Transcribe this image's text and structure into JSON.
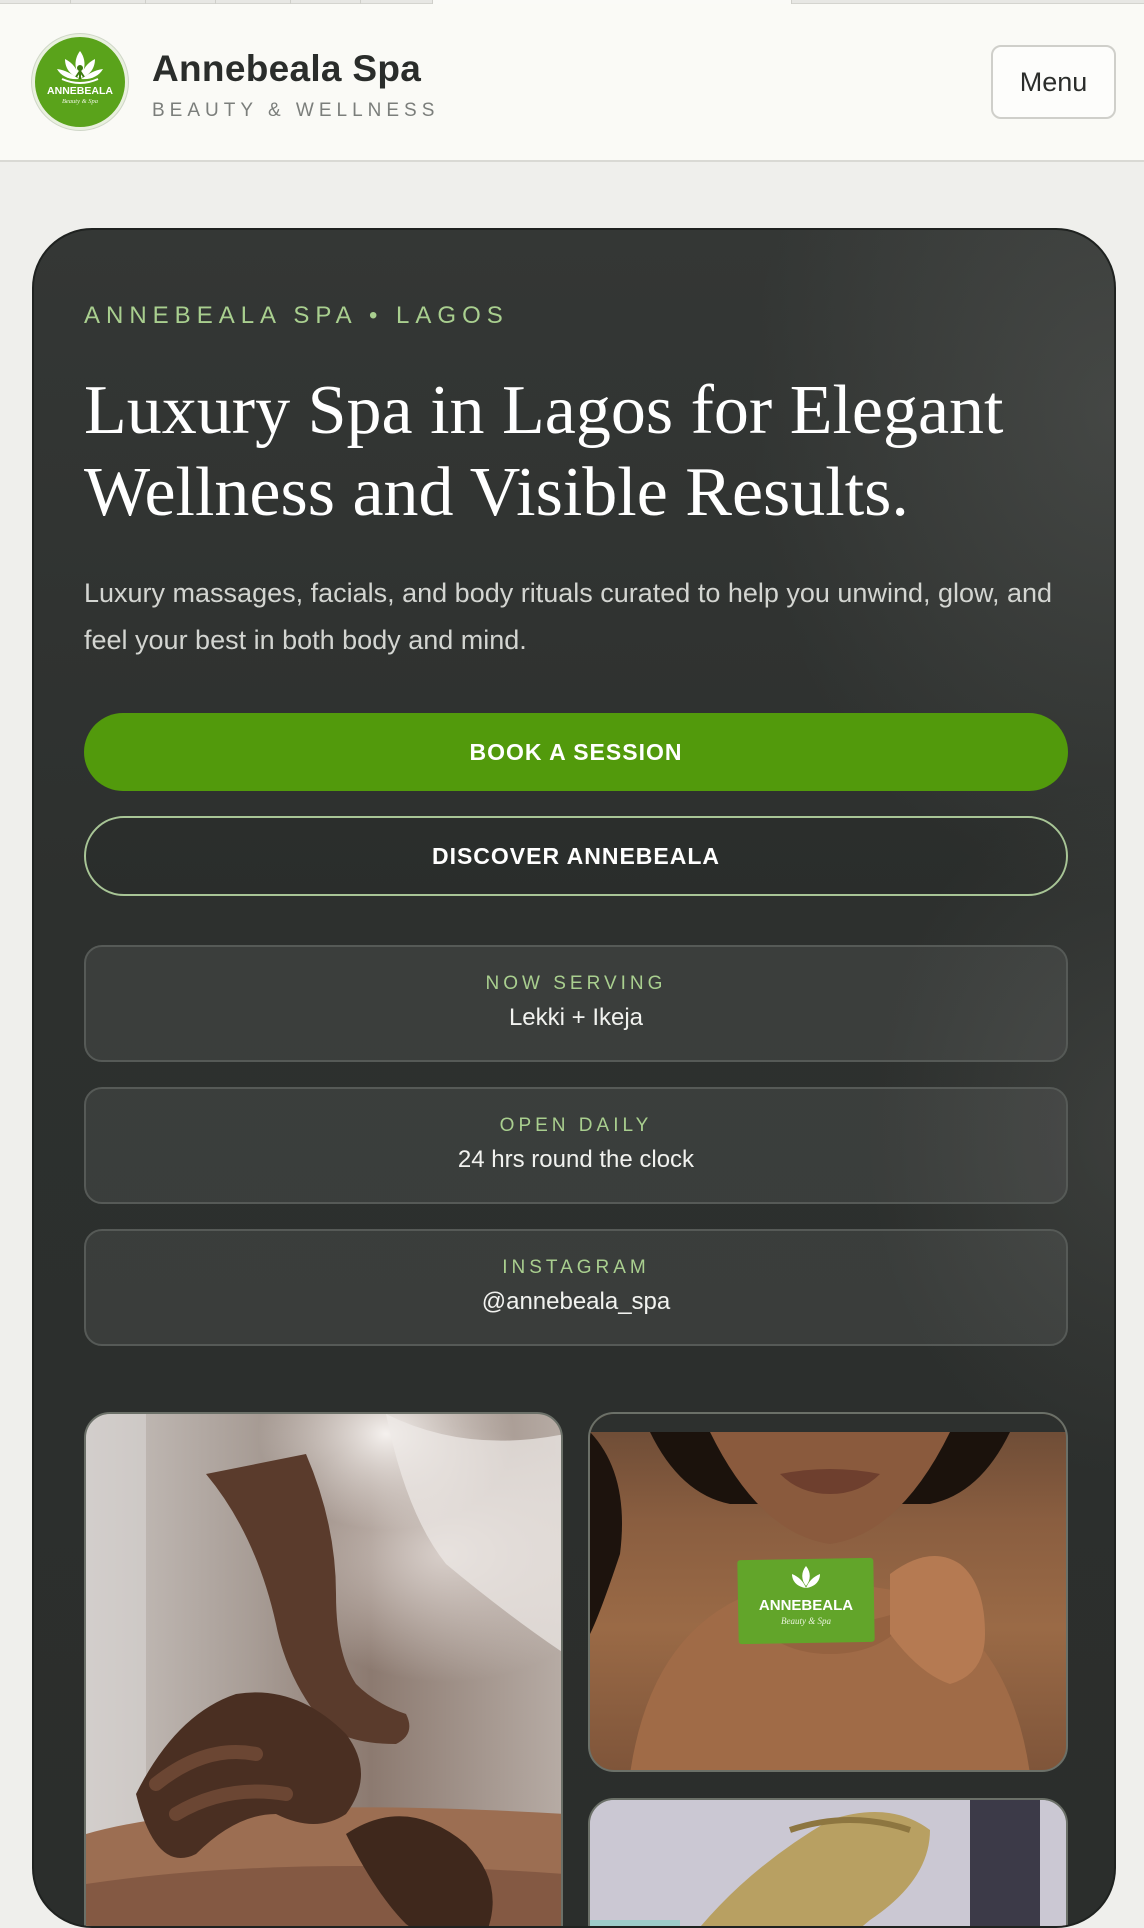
{
  "header": {
    "logo_alt": "Annebeala logo",
    "logo_text": "ANNEBEALA",
    "logo_subtext": "Beauty & Spa",
    "brand_name": "Annebeala Spa",
    "brand_tagline": "BEAUTY & WELLNESS",
    "menu_label": "Menu",
    "colors": {
      "header_bg": "#fafaf6",
      "logo_green": "#5aa31b"
    }
  },
  "hero": {
    "eyebrow": "ANNEBEALA SPA • LAGOS",
    "headline": "Luxury Spa in Lagos for Elegant Wellness and Visible Results.",
    "subcopy": "Luxury massages, facials, and body rituals curated to help you unwind, glow, and feel your best in both body and mind.",
    "primary_cta": "BOOK A SESSION",
    "secondary_cta": "DISCOVER ANNEBEALA",
    "info_cards": [
      {
        "label": "NOW SERVING",
        "value": "Lekki + Ikeja"
      },
      {
        "label": "OPEN DAILY",
        "value": "24 hrs round the clock"
      },
      {
        "label": "INSTAGRAM",
        "value": "@annebeala_spa"
      }
    ],
    "colors": {
      "accent": "#529a0c",
      "eyebrow": "#a9cf8f",
      "card_bg": "#2d302e"
    }
  },
  "gallery": {
    "photos": [
      {
        "name": "massage-photo"
      },
      {
        "name": "business-card-photo",
        "card_text": "ANNEBEALA",
        "card_subtext": "Beauty & Spa"
      },
      {
        "name": "foot-treatment-photo"
      }
    ]
  }
}
